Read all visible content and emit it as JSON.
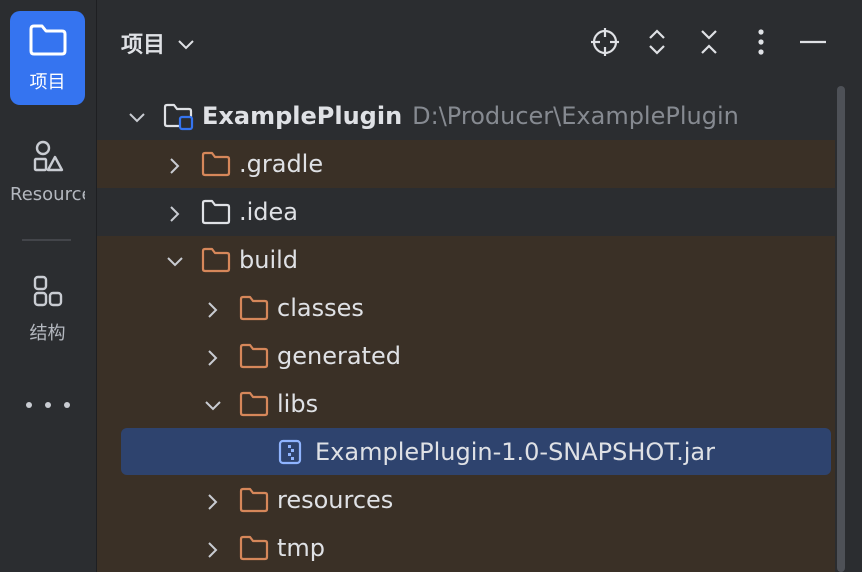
{
  "sidebar": {
    "project_label": "项目",
    "resources_label": "Resources",
    "structure_label": "结构"
  },
  "header": {
    "title": "项目",
    "icons": [
      "locate-icon",
      "expand-all-icon",
      "collapse-all-icon",
      "more-options-icon",
      "minimize-icon"
    ]
  },
  "tree": {
    "root": {
      "name": "ExamplePlugin",
      "path": "D:\\Producer\\ExamplePlugin"
    },
    "items": [
      {
        "name": ".gradle",
        "state": "collapsed",
        "excluded": true
      },
      {
        "name": ".idea",
        "state": "collapsed",
        "excluded": false
      },
      {
        "name": "build",
        "state": "expanded",
        "excluded": true
      },
      {
        "name": "classes",
        "state": "collapsed",
        "excluded": true
      },
      {
        "name": "generated",
        "state": "collapsed",
        "excluded": true
      },
      {
        "name": "libs",
        "state": "expanded",
        "excluded": true
      },
      {
        "name": "ExamplePlugin-1.0-SNAPSHOT.jar",
        "type": "jar",
        "selected": true
      },
      {
        "name": "resources",
        "state": "collapsed",
        "excluded": true
      },
      {
        "name": "tmp",
        "state": "collapsed",
        "excluded": true
      }
    ]
  },
  "colors": {
    "background": "#2b2d30",
    "accent": "#3574f0",
    "excluded_folder": "#d6875a",
    "excluded_row": "#3a3026",
    "selection": "#2e436e"
  }
}
